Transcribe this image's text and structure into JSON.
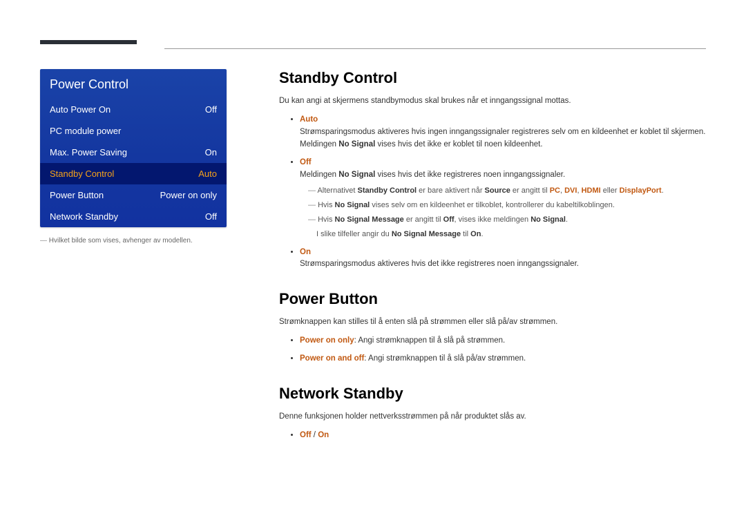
{
  "menu": {
    "title": "Power Control",
    "rows": [
      {
        "label": "Auto Power On",
        "value": "Off"
      },
      {
        "label": "PC module power",
        "value": ""
      },
      {
        "label": "Max. Power Saving",
        "value": "On"
      },
      {
        "label": "Standby Control",
        "value": "Auto",
        "selected": true
      },
      {
        "label": "Power Button",
        "value": "Power on only"
      },
      {
        "label": "Network Standby",
        "value": "Off"
      }
    ],
    "note": "Hvilket bilde som vises, avhenger av modellen."
  },
  "sections": {
    "standby": {
      "heading": "Standby Control",
      "intro": "Du kan angi at skjermens standbymodus skal brukes når et inngangssignal mottas.",
      "auto": {
        "label": "Auto",
        "line1a": "Strømsparingsmodus aktiveres hvis ingen inngangssignaler registreres selv om en kildeenhet er koblet til skjermen.",
        "line2_pre": "Meldingen ",
        "line2_key": "No Signal",
        "line2_post": " vises hvis det ikke er koblet til noen kildeenhet."
      },
      "off": {
        "label": "Off",
        "line_pre": "Meldingen ",
        "line_key": "No Signal",
        "line_post": " vises hvis det ikke registreres noen inngangssignaler.",
        "sub1_a": "Alternativet ",
        "sub1_b": "Standby Control",
        "sub1_c": " er bare aktivert når ",
        "sub1_d": "Source",
        "sub1_e": " er angitt til ",
        "sub1_pc": "PC",
        "sub1_dvi": "DVI",
        "sub1_hdmi": "HDMI",
        "sub1_or": " eller ",
        "sub1_dp": "DisplayPort",
        "sub1_end": ".",
        "sub2_pre": "Hvis ",
        "sub2_key": "No Signal",
        "sub2_post": " vises selv om en kildeenhet er tilkoblet, kontrollerer du kabeltilkoblingen.",
        "sub3_pre": "Hvis ",
        "sub3_key1": "No Signal Message",
        "sub3_mid": " er angitt til ",
        "sub3_key2": "Off",
        "sub3_mid2": ", vises ikke meldingen ",
        "sub3_key3": "No Signal",
        "sub3_end": ".",
        "sub4_pre": "I slike tilfeller angir du ",
        "sub4_key1": "No Signal Message",
        "sub4_mid": " til ",
        "sub4_key2": "On",
        "sub4_end": "."
      },
      "on": {
        "label": "On",
        "line": "Strømsparingsmodus aktiveres hvis det ikke registreres noen inngangssignaler."
      }
    },
    "powerButton": {
      "heading": "Power Button",
      "intro": "Strømknappen kan stilles til å enten slå på strømmen eller slå på/av strømmen.",
      "opt1_label": "Power on only",
      "opt1_text": ": Angi strømknappen til å slå på strømmen.",
      "opt2_label": "Power on and off",
      "opt2_text": ": Angi strømknappen til å slå på/av strømmen."
    },
    "network": {
      "heading": "Network Standby",
      "intro": "Denne funksjonen holder nettverksstrømmen på når produktet slås av.",
      "off": "Off",
      "sep": " / ",
      "on": "On"
    }
  }
}
